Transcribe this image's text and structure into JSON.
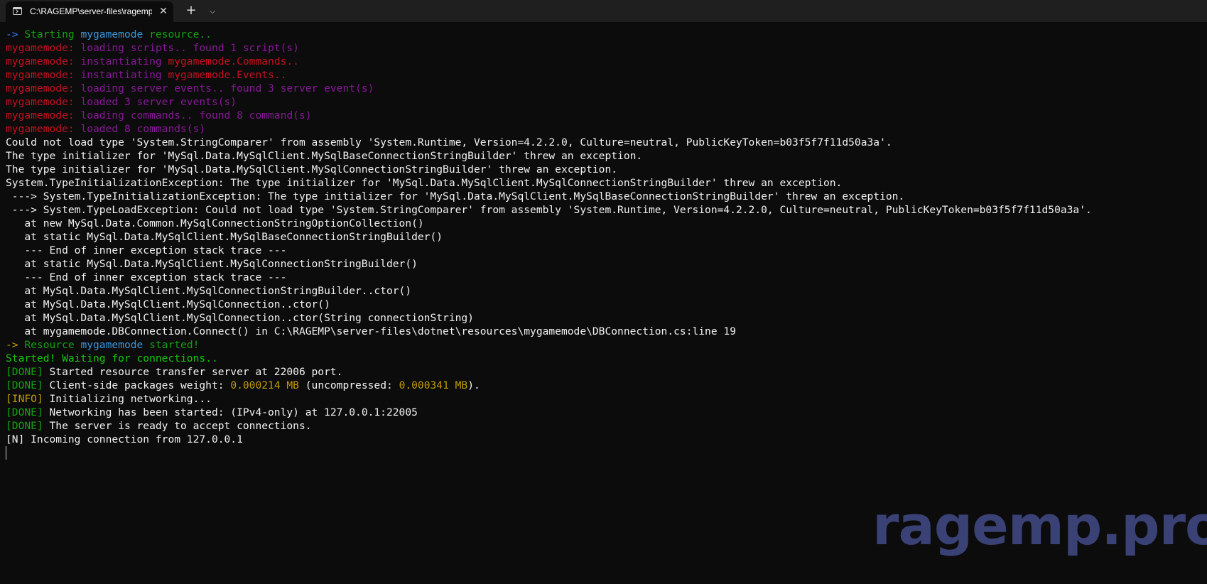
{
  "titlebar": {
    "tab_title": "C:\\RAGEMP\\server-files\\ragemp-server.exe",
    "close_symbol": "✕",
    "new_tab_symbol": "+",
    "dropdown_symbol": "⌵",
    "icons": {
      "terminal": "terminal-icon",
      "close": "close-icon",
      "new_tab": "plus-icon",
      "dropdown": "chevron-down-icon"
    }
  },
  "console": {
    "lines": [
      {
        "segments": [
          {
            "text": "-> ",
            "color": "#3b78ff"
          },
          {
            "text": "Starting ",
            "color": "#13a10e"
          },
          {
            "text": "mygamemode",
            "color": "#3a96dd"
          },
          {
            "text": " resource..",
            "color": "#13a10e"
          }
        ]
      },
      {
        "segments": [
          {
            "text": "mygamemode: ",
            "color": "#c50f1f"
          },
          {
            "text": "loading scripts.. found 1 script(s)",
            "color": "#881798"
          }
        ]
      },
      {
        "segments": [
          {
            "text": "mygamemode: ",
            "color": "#c50f1f"
          },
          {
            "text": "instantiating ",
            "color": "#881798"
          },
          {
            "text": "mygamemode.Commands..",
            "color": "#c50f1f"
          }
        ]
      },
      {
        "segments": [
          {
            "text": "mygamemode: ",
            "color": "#c50f1f"
          },
          {
            "text": "instantiating ",
            "color": "#881798"
          },
          {
            "text": "mygamemode.Events..",
            "color": "#c50f1f"
          }
        ]
      },
      {
        "segments": [
          {
            "text": "mygamemode: ",
            "color": "#c50f1f"
          },
          {
            "text": "loading server events.. found 3 server event(s)",
            "color": "#881798"
          }
        ]
      },
      {
        "segments": [
          {
            "text": "mygamemode: ",
            "color": "#c50f1f"
          },
          {
            "text": "loaded 3 server events(s)",
            "color": "#881798"
          }
        ]
      },
      {
        "segments": [
          {
            "text": "mygamemode: ",
            "color": "#c50f1f"
          },
          {
            "text": "loading commands.. found 8 command(s)",
            "color": "#881798"
          }
        ]
      },
      {
        "segments": [
          {
            "text": "mygamemode: ",
            "color": "#c50f1f"
          },
          {
            "text": "loaded 8 commands(s)",
            "color": "#881798"
          }
        ]
      },
      {
        "segments": [
          {
            "text": "Could not load type 'System.StringComparer' from assembly 'System.Runtime, Version=4.2.2.0, Culture=neutral, PublicKeyToken=b03f5f7f11d50a3a'.",
            "color": "#f2f2f2"
          }
        ]
      },
      {
        "segments": [
          {
            "text": "The type initializer for 'MySql.Data.MySqlClient.MySqlBaseConnectionStringBuilder' threw an exception.",
            "color": "#f2f2f2"
          }
        ]
      },
      {
        "segments": [
          {
            "text": "The type initializer for 'MySql.Data.MySqlClient.MySqlConnectionStringBuilder' threw an exception.",
            "color": "#f2f2f2"
          }
        ]
      },
      {
        "segments": [
          {
            "text": "System.TypeInitializationException: The type initializer for 'MySql.Data.MySqlClient.MySqlConnectionStringBuilder' threw an exception.",
            "color": "#f2f2f2"
          }
        ]
      },
      {
        "segments": [
          {
            "text": " ---> System.TypeInitializationException: The type initializer for 'MySql.Data.MySqlClient.MySqlBaseConnectionStringBuilder' threw an exception.",
            "color": "#f2f2f2"
          }
        ]
      },
      {
        "segments": [
          {
            "text": " ---> System.TypeLoadException: Could not load type 'System.StringComparer' from assembly 'System.Runtime, Version=4.2.2.0, Culture=neutral, PublicKeyToken=b03f5f7f11d50a3a'.",
            "color": "#f2f2f2"
          }
        ]
      },
      {
        "segments": [
          {
            "text": "   at new MySql.Data.Common.MySqlConnectionStringOptionCollection()",
            "color": "#f2f2f2"
          }
        ]
      },
      {
        "segments": [
          {
            "text": "   at static MySql.Data.MySqlClient.MySqlBaseConnectionStringBuilder()",
            "color": "#f2f2f2"
          }
        ]
      },
      {
        "segments": [
          {
            "text": "   --- End of inner exception stack trace ---",
            "color": "#f2f2f2"
          }
        ]
      },
      {
        "segments": [
          {
            "text": "   at static MySql.Data.MySqlClient.MySqlConnectionStringBuilder()",
            "color": "#f2f2f2"
          }
        ]
      },
      {
        "segments": [
          {
            "text": "   --- End of inner exception stack trace ---",
            "color": "#f2f2f2"
          }
        ]
      },
      {
        "segments": [
          {
            "text": "   at MySql.Data.MySqlClient.MySqlConnectionStringBuilder..ctor()",
            "color": "#f2f2f2"
          }
        ]
      },
      {
        "segments": [
          {
            "text": "   at MySql.Data.MySqlClient.MySqlConnection..ctor()",
            "color": "#f2f2f2"
          }
        ]
      },
      {
        "segments": [
          {
            "text": "   at MySql.Data.MySqlClient.MySqlConnection..ctor(String connectionString)",
            "color": "#f2f2f2"
          }
        ]
      },
      {
        "segments": [
          {
            "text": "   at mygamemode.DBConnection.Connect() in C:\\RAGEMP\\server-files\\dotnet\\resources\\mygamemode\\DBConnection.cs:line 19",
            "color": "#f2f2f2"
          }
        ]
      },
      {
        "segments": [
          {
            "text": "-> ",
            "color": "#c19c00"
          },
          {
            "text": "Resource ",
            "color": "#13a10e"
          },
          {
            "text": "mygamemode",
            "color": "#3a96dd"
          },
          {
            "text": " started!",
            "color": "#13a10e"
          }
        ]
      },
      {
        "segments": [
          {
            "text": "Started! Waiting for connections..",
            "color": "#16c60c"
          }
        ]
      },
      {
        "segments": [
          {
            "text": "[DONE]",
            "color": "#13a10e"
          },
          {
            "text": " Started resource transfer server at 22006 port.",
            "color": "#f2f2f2"
          }
        ]
      },
      {
        "segments": [
          {
            "text": "[DONE]",
            "color": "#13a10e"
          },
          {
            "text": " Client-side packages weight: ",
            "color": "#f2f2f2"
          },
          {
            "text": "0.000214 MB",
            "color": "#c19c00"
          },
          {
            "text": " (uncompressed: ",
            "color": "#f2f2f2"
          },
          {
            "text": "0.000341 MB",
            "color": "#c19c00"
          },
          {
            "text": ").",
            "color": "#f2f2f2"
          }
        ]
      },
      {
        "segments": [
          {
            "text": "[INFO]",
            "color": "#c19c00"
          },
          {
            "text": " Initializing networking...",
            "color": "#f2f2f2"
          }
        ]
      },
      {
        "segments": [
          {
            "text": "[DONE]",
            "color": "#13a10e"
          },
          {
            "text": " Networking has been started: (IPv4-only) at 127.0.0.1:22005",
            "color": "#f2f2f2"
          }
        ]
      },
      {
        "segments": [
          {
            "text": "[DONE]",
            "color": "#13a10e"
          },
          {
            "text": " The server is ready to accept connections.",
            "color": "#f2f2f2"
          }
        ]
      },
      {
        "segments": [
          {
            "text": "[N] Incoming connection from 127.0.0.1",
            "color": "#f2f2f2"
          }
        ]
      }
    ]
  },
  "watermark": {
    "text": "ragemp.pro",
    "color": "#3a4175"
  }
}
